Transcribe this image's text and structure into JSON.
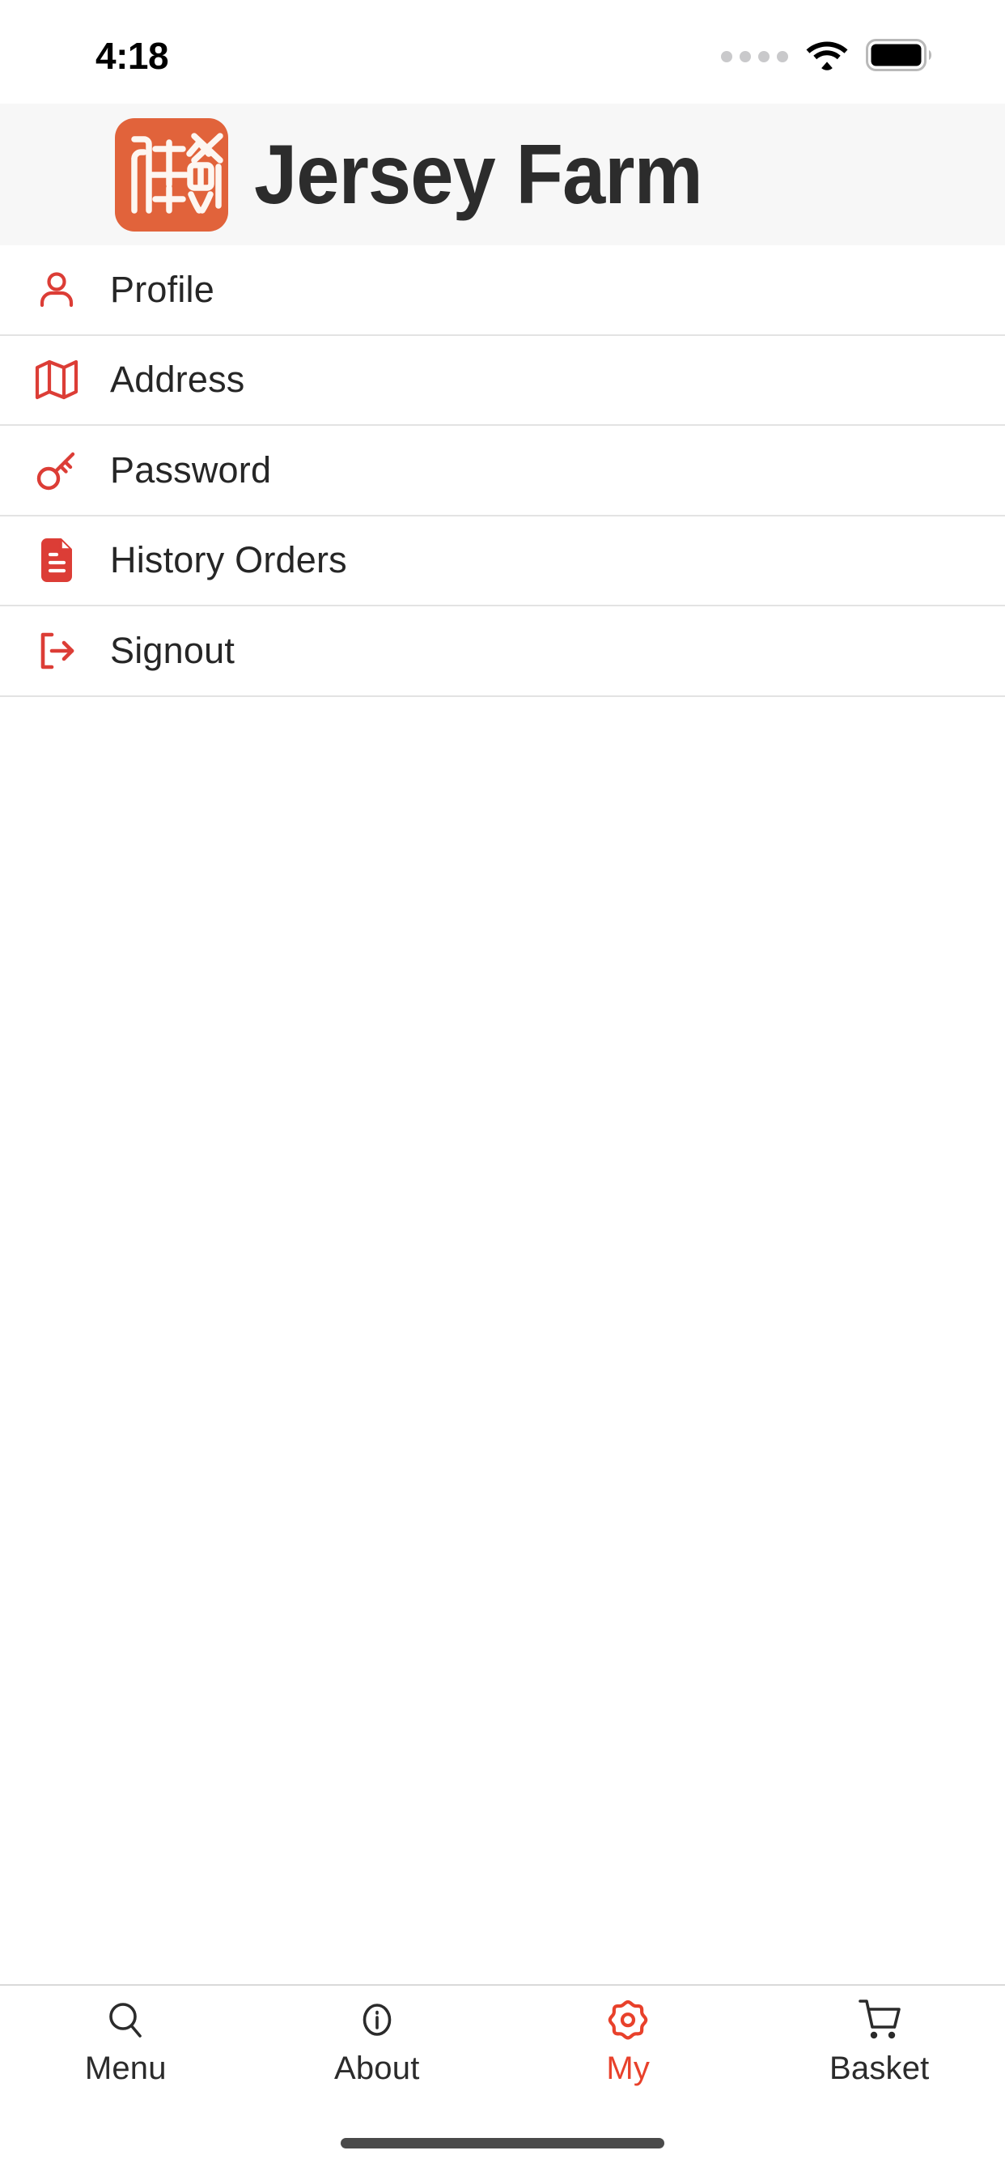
{
  "status_bar": {
    "time": "4:18",
    "signal_icon": "signal-dots-icon",
    "wifi_icon": "wifi-icon",
    "battery_icon": "battery-full-icon"
  },
  "header": {
    "title": "Jersey Farm",
    "logo_icon": "brand-seal-logo-icon",
    "logo_color": "#E1633B",
    "background_color": "#F7F7F7",
    "title_color": "#2C2C2C"
  },
  "menu": {
    "items": [
      {
        "label": "Profile",
        "icon": "user-icon"
      },
      {
        "label": "Address",
        "icon": "map-icon"
      },
      {
        "label": "Password",
        "icon": "key-icon"
      },
      {
        "label": "History Orders",
        "icon": "document-icon"
      },
      {
        "label": "Signout",
        "icon": "logout-icon"
      }
    ],
    "icon_color": "#DC3D36",
    "label_color": "#262626",
    "divider_color": "#E3E3E3"
  },
  "tab_bar": {
    "items": [
      {
        "label": "Menu",
        "icon": "search-icon",
        "active": false
      },
      {
        "label": "About",
        "icon": "info-circle-icon",
        "active": false
      },
      {
        "label": "My",
        "icon": "gear-icon",
        "active": true
      },
      {
        "label": "Basket",
        "icon": "shopping-cart-icon",
        "active": false
      }
    ],
    "active_color": "#E8412B",
    "inactive_color": "#2B2B2B"
  },
  "home_indicator": {
    "icon": "home-indicator-bar"
  }
}
